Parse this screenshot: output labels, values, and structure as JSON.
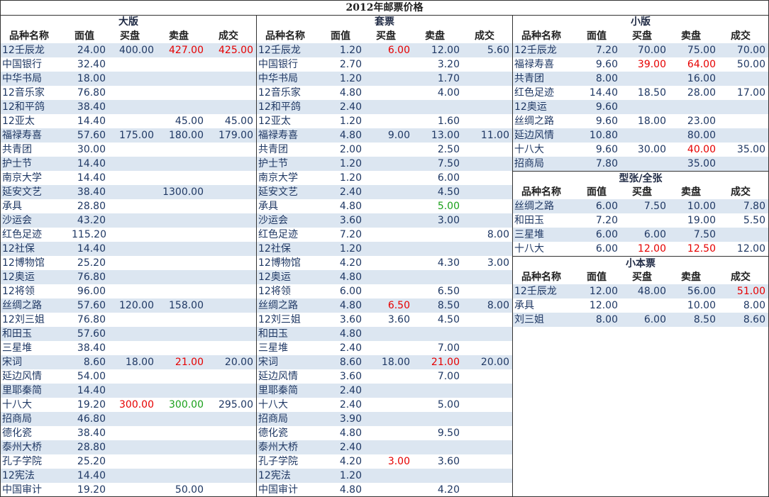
{
  "title": "2012年邮票价格",
  "headers": [
    "品种名称",
    "面值",
    "买盘",
    "卖盘",
    "成交"
  ],
  "colors": {
    "alt_row": "#dce6f1",
    "text": "#1f3864",
    "red": "#e60000",
    "green": "#1aa01a"
  },
  "panels": [
    {
      "id": "large",
      "sections": [
        {
          "title": "大版",
          "rows": [
            {
              "name": "12壬辰龙",
              "face": "24.00",
              "bid": "400.00",
              "ask": "427.00",
              "deal": "425.00",
              "ask_color": "red",
              "deal_color": "red"
            },
            {
              "name": "中国银行",
              "face": "32.40",
              "bid": "",
              "ask": "",
              "deal": ""
            },
            {
              "name": "中华书局",
              "face": "18.00",
              "bid": "",
              "ask": "",
              "deal": ""
            },
            {
              "name": "12音乐家",
              "face": "76.80",
              "bid": "",
              "ask": "",
              "deal": ""
            },
            {
              "name": "12和平鸽",
              "face": "38.40",
              "bid": "",
              "ask": "",
              "deal": ""
            },
            {
              "name": "12亚太",
              "face": "14.40",
              "bid": "",
              "ask": "45.00",
              "deal": "45.00"
            },
            {
              "name": "福禄寿喜",
              "face": "57.60",
              "bid": "175.00",
              "ask": "180.00",
              "deal": "179.00"
            },
            {
              "name": "共青团",
              "face": "30.00",
              "bid": "",
              "ask": "",
              "deal": ""
            },
            {
              "name": "护士节",
              "face": "14.40",
              "bid": "",
              "ask": "",
              "deal": ""
            },
            {
              "name": "南京大学",
              "face": "14.40",
              "bid": "",
              "ask": "",
              "deal": ""
            },
            {
              "name": "延安文艺",
              "face": "38.40",
              "bid": "",
              "ask": "1300.00",
              "deal": ""
            },
            {
              "name": "承具",
              "face": "28.80",
              "bid": "",
              "ask": "",
              "deal": ""
            },
            {
              "name": "沙运会",
              "face": "43.20",
              "bid": "",
              "ask": "",
              "deal": ""
            },
            {
              "name": "红色足迹",
              "face": "115.20",
              "bid": "",
              "ask": "",
              "deal": ""
            },
            {
              "name": "12社保",
              "face": "14.40",
              "bid": "",
              "ask": "",
              "deal": ""
            },
            {
              "name": "12博物馆",
              "face": "25.20",
              "bid": "",
              "ask": "",
              "deal": ""
            },
            {
              "name": "12奥运",
              "face": "76.80",
              "bid": "",
              "ask": "",
              "deal": ""
            },
            {
              "name": "12将领",
              "face": "96.00",
              "bid": "",
              "ask": "",
              "deal": ""
            },
            {
              "name": "丝绸之路",
              "face": "57.60",
              "bid": "120.00",
              "ask": "158.00",
              "deal": ""
            },
            {
              "name": "12刘三姐",
              "face": "76.80",
              "bid": "",
              "ask": "",
              "deal": ""
            },
            {
              "name": "和田玉",
              "face": "57.60",
              "bid": "",
              "ask": "",
              "deal": ""
            },
            {
              "name": "三星堆",
              "face": "38.40",
              "bid": "",
              "ask": "",
              "deal": ""
            },
            {
              "name": "宋词",
              "face": "8.60",
              "bid": "18.00",
              "ask": "21.00",
              "deal": "20.00",
              "ask_color": "red"
            },
            {
              "name": "延边风情",
              "face": "54.00",
              "bid": "",
              "ask": "",
              "deal": ""
            },
            {
              "name": "里耶秦简",
              "face": "14.40",
              "bid": "",
              "ask": "",
              "deal": ""
            },
            {
              "name": "十八大",
              "face": "19.20",
              "bid": "300.00",
              "ask": "300.00",
              "deal": "295.00",
              "bid_color": "red",
              "ask_color": "green"
            },
            {
              "name": "招商局",
              "face": "46.80",
              "bid": "",
              "ask": "",
              "deal": ""
            },
            {
              "name": "德化瓷",
              "face": "38.40",
              "bid": "",
              "ask": "",
              "deal": ""
            },
            {
              "name": "泰州大桥",
              "face": "28.80",
              "bid": "",
              "ask": "",
              "deal": ""
            },
            {
              "name": "孔子学院",
              "face": "25.20",
              "bid": "",
              "ask": "",
              "deal": ""
            },
            {
              "name": "12宪法",
              "face": "14.40",
              "bid": "",
              "ask": "",
              "deal": ""
            },
            {
              "name": "中国审计",
              "face": "19.20",
              "bid": "",
              "ask": "50.00",
              "deal": ""
            }
          ]
        }
      ]
    },
    {
      "id": "set",
      "sections": [
        {
          "title": "套票",
          "rows": [
            {
              "name": "12壬辰龙",
              "face": "1.20",
              "bid": "6.00",
              "ask": "12.00",
              "deal": "5.60",
              "bid_color": "red"
            },
            {
              "name": "中国银行",
              "face": "2.70",
              "bid": "",
              "ask": "3.20",
              "deal": ""
            },
            {
              "name": "中华书局",
              "face": "1.20",
              "bid": "",
              "ask": "1.70",
              "deal": ""
            },
            {
              "name": "12音乐家",
              "face": "4.80",
              "bid": "",
              "ask": "4.00",
              "deal": ""
            },
            {
              "name": "12和平鸽",
              "face": "2.40",
              "bid": "",
              "ask": "",
              "deal": ""
            },
            {
              "name": "12亚太",
              "face": "1.20",
              "bid": "",
              "ask": "1.60",
              "deal": ""
            },
            {
              "name": "福禄寿喜",
              "face": "4.80",
              "bid": "9.00",
              "ask": "13.00",
              "deal": "11.00"
            },
            {
              "name": "共青团",
              "face": "2.00",
              "bid": "",
              "ask": "2.50",
              "deal": ""
            },
            {
              "name": "护士节",
              "face": "1.20",
              "bid": "",
              "ask": "7.50",
              "deal": ""
            },
            {
              "name": "南京大学",
              "face": "1.20",
              "bid": "",
              "ask": "6.00",
              "deal": ""
            },
            {
              "name": "延安文艺",
              "face": "2.40",
              "bid": "",
              "ask": "4.50",
              "deal": ""
            },
            {
              "name": "承具",
              "face": "4.80",
              "bid": "",
              "ask": "5.00",
              "deal": "",
              "ask_color": "green"
            },
            {
              "name": "沙运会",
              "face": "3.60",
              "bid": "",
              "ask": "3.00",
              "deal": ""
            },
            {
              "name": "红色足迹",
              "face": "7.20",
              "bid": "",
              "ask": "",
              "deal": "8.00"
            },
            {
              "name": "12社保",
              "face": "1.20",
              "bid": "",
              "ask": "",
              "deal": ""
            },
            {
              "name": "12博物馆",
              "face": "4.20",
              "bid": "",
              "ask": "4.30",
              "deal": "3.00"
            },
            {
              "name": "12奥运",
              "face": "4.80",
              "bid": "",
              "ask": "",
              "deal": ""
            },
            {
              "name": "12将领",
              "face": "6.00",
              "bid": "",
              "ask": "6.50",
              "deal": ""
            },
            {
              "name": "丝绸之路",
              "face": "4.80",
              "bid": "6.50",
              "ask": "8.50",
              "deal": "8.00",
              "bid_color": "red"
            },
            {
              "name": "12刘三姐",
              "face": "3.60",
              "bid": "3.60",
              "ask": "4.50",
              "deal": ""
            },
            {
              "name": "和田玉",
              "face": "4.80",
              "bid": "",
              "ask": "",
              "deal": ""
            },
            {
              "name": "三星堆",
              "face": "2.40",
              "bid": "",
              "ask": "7.00",
              "deal": ""
            },
            {
              "name": "宋词",
              "face": "8.60",
              "bid": "18.00",
              "ask": "21.00",
              "deal": "20.00",
              "ask_color": "red"
            },
            {
              "name": "延边风情",
              "face": "3.60",
              "bid": "",
              "ask": "7.00",
              "deal": ""
            },
            {
              "name": "里耶秦简",
              "face": "2.40",
              "bid": "",
              "ask": "",
              "deal": ""
            },
            {
              "name": "十八大",
              "face": "2.40",
              "bid": "",
              "ask": "5.00",
              "deal": ""
            },
            {
              "name": "招商局",
              "face": "3.90",
              "bid": "",
              "ask": "",
              "deal": ""
            },
            {
              "name": "德化瓷",
              "face": "4.80",
              "bid": "",
              "ask": "9.50",
              "deal": ""
            },
            {
              "name": "泰州大桥",
              "face": "2.40",
              "bid": "",
              "ask": "",
              "deal": ""
            },
            {
              "name": "孔子学院",
              "face": "4.20",
              "bid": "3.00",
              "ask": "3.60",
              "deal": "",
              "bid_color": "red"
            },
            {
              "name": "12宪法",
              "face": "1.20",
              "bid": "",
              "ask": "",
              "deal": ""
            },
            {
              "name": "中国审计",
              "face": "4.80",
              "bid": "",
              "ask": "4.20",
              "deal": ""
            }
          ]
        }
      ]
    },
    {
      "id": "small",
      "sections": [
        {
          "title": "小版",
          "rows": [
            {
              "name": "12壬辰龙",
              "face": "7.20",
              "bid": "70.00",
              "ask": "75.00",
              "deal": "70.00"
            },
            {
              "name": "福禄寿喜",
              "face": "9.60",
              "bid": "39.00",
              "ask": "64.00",
              "deal": "50.00",
              "bid_color": "red",
              "ask_color": "red"
            },
            {
              "name": "共青团",
              "face": "8.00",
              "bid": "",
              "ask": "16.00",
              "deal": ""
            },
            {
              "name": "红色足迹",
              "face": "14.40",
              "bid": "18.50",
              "ask": "28.00",
              "deal": "17.00"
            },
            {
              "name": "12奥运",
              "face": "9.60",
              "bid": "",
              "ask": "",
              "deal": ""
            },
            {
              "name": "丝绸之路",
              "face": "9.60",
              "bid": "18.00",
              "ask": "23.00",
              "deal": ""
            },
            {
              "name": "延边风情",
              "face": "10.80",
              "bid": "",
              "ask": "80.00",
              "deal": ""
            },
            {
              "name": "十八大",
              "face": "9.60",
              "bid": "30.00",
              "ask": "40.00",
              "deal": "35.00",
              "ask_color": "red"
            },
            {
              "name": "招商局",
              "face": "7.80",
              "bid": "",
              "ask": "35.00",
              "deal": ""
            }
          ]
        },
        {
          "title": "型张/全张",
          "rows": [
            {
              "name": "丝绸之路",
              "face": "6.00",
              "bid": "7.50",
              "ask": "10.00",
              "deal": "7.80"
            },
            {
              "name": "和田玉",
              "face": "7.20",
              "bid": "",
              "ask": "19.00",
              "deal": "5.50"
            },
            {
              "name": "三星堆",
              "face": "6.00",
              "bid": "6.00",
              "ask": "7.50",
              "deal": ""
            },
            {
              "name": "十八大",
              "face": "6.00",
              "bid": "12.00",
              "ask": "12.50",
              "deal": "12.00",
              "bid_color": "red",
              "ask_color": "red"
            }
          ]
        },
        {
          "title": "小本票",
          "rows": [
            {
              "name": "12壬辰龙",
              "face": "12.00",
              "bid": "48.00",
              "ask": "56.00",
              "deal": "51.00",
              "deal_color": "red"
            },
            {
              "name": "承具",
              "face": "12.00",
              "bid": "",
              "ask": "10.00",
              "deal": "8.00"
            },
            {
              "name": "刘三姐",
              "face": "8.00",
              "bid": "6.00",
              "ask": "8.50",
              "deal": "8.60"
            }
          ]
        }
      ]
    }
  ]
}
